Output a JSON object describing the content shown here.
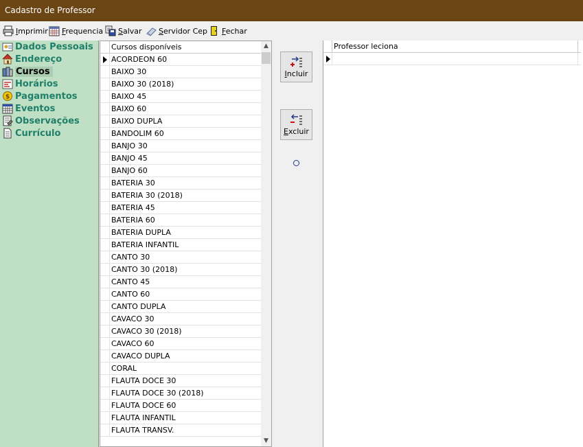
{
  "window": {
    "title": "Cadastro de Professor"
  },
  "toolbar": {
    "items": [
      {
        "name": "imprimir",
        "label": "Imprimir",
        "mnemonic": "I",
        "rest": "mprimir",
        "icon": "printer-icon"
      },
      {
        "name": "frequencia",
        "label": "Frequencia",
        "mnemonic": "F",
        "rest": "requencia",
        "icon": "calendar-icon"
      },
      {
        "name": "salvar",
        "label": "Salvar",
        "mnemonic": "S",
        "rest": "alvar",
        "icon": "save-icon"
      },
      {
        "name": "servidor-cep",
        "label": "Servidor Cep",
        "mnemonic": "S",
        "rest": "ervidor Cep",
        "icon": "server-icon"
      },
      {
        "name": "fechar",
        "label": "Fechar",
        "mnemonic": "F",
        "rest": "echar",
        "icon": "exit-door-icon"
      }
    ]
  },
  "sidebar": {
    "items": [
      {
        "label": "Dados Pessoais",
        "icon": "person-card-icon",
        "active": false
      },
      {
        "label": "Endereço",
        "icon": "house-icon",
        "active": false
      },
      {
        "label": "Cursos",
        "icon": "books-icon",
        "active": true
      },
      {
        "label": "Horários",
        "icon": "schedule-icon",
        "active": false
      },
      {
        "label": "Pagamentos",
        "icon": "coin-icon",
        "active": false
      },
      {
        "label": "Eventos",
        "icon": "calendar-grid-icon",
        "active": false
      },
      {
        "label": "Observações",
        "icon": "notes-icon",
        "active": false
      },
      {
        "label": "Currículo",
        "icon": "document-icon",
        "active": false
      }
    ]
  },
  "available_courses": {
    "header": "Cursos disponíveis",
    "rows": [
      "ACORDEON 60",
      "BAIXO 30",
      "BAIXO 30 (2018)",
      "BAIXO 45",
      "BAIXO 60",
      "BAIXO DUPLA",
      "BANDOLIM 60",
      "BANJO 30",
      "BANJO 45",
      "BANJO 60",
      "BATERIA 30",
      "BATERIA 30 (2018)",
      "BATERIA 45",
      "BATERIA 60",
      "BATERIA DUPLA",
      "BATERIA INFANTIL",
      "CANTO 30",
      "CANTO 30 (2018)",
      "CANTO 45",
      "CANTO 60",
      "CANTO DUPLA",
      "CAVACO 30",
      "CAVACO 30 (2018)",
      "CAVACO 60",
      "CAVACO DUPLA",
      "CORAL",
      "FLAUTA DOCE 30",
      "FLAUTA DOCE 30 (2018)",
      "FLAUTA DOCE 60",
      "FLAUTA INFANTIL",
      "FLAUTA TRANSV."
    ],
    "scroll_up": "▲",
    "scroll_down": "▼"
  },
  "actions": {
    "incluir": {
      "mnemonic": "I",
      "rest": "ncluir",
      "icon": "add-transfer-icon"
    },
    "excluir": {
      "mnemonic": "E",
      "rest": "xcluir",
      "icon": "remove-transfer-icon"
    },
    "indicator": "clock-icon"
  },
  "teacher_courses": {
    "header": "Professor leciona",
    "rows": []
  }
}
